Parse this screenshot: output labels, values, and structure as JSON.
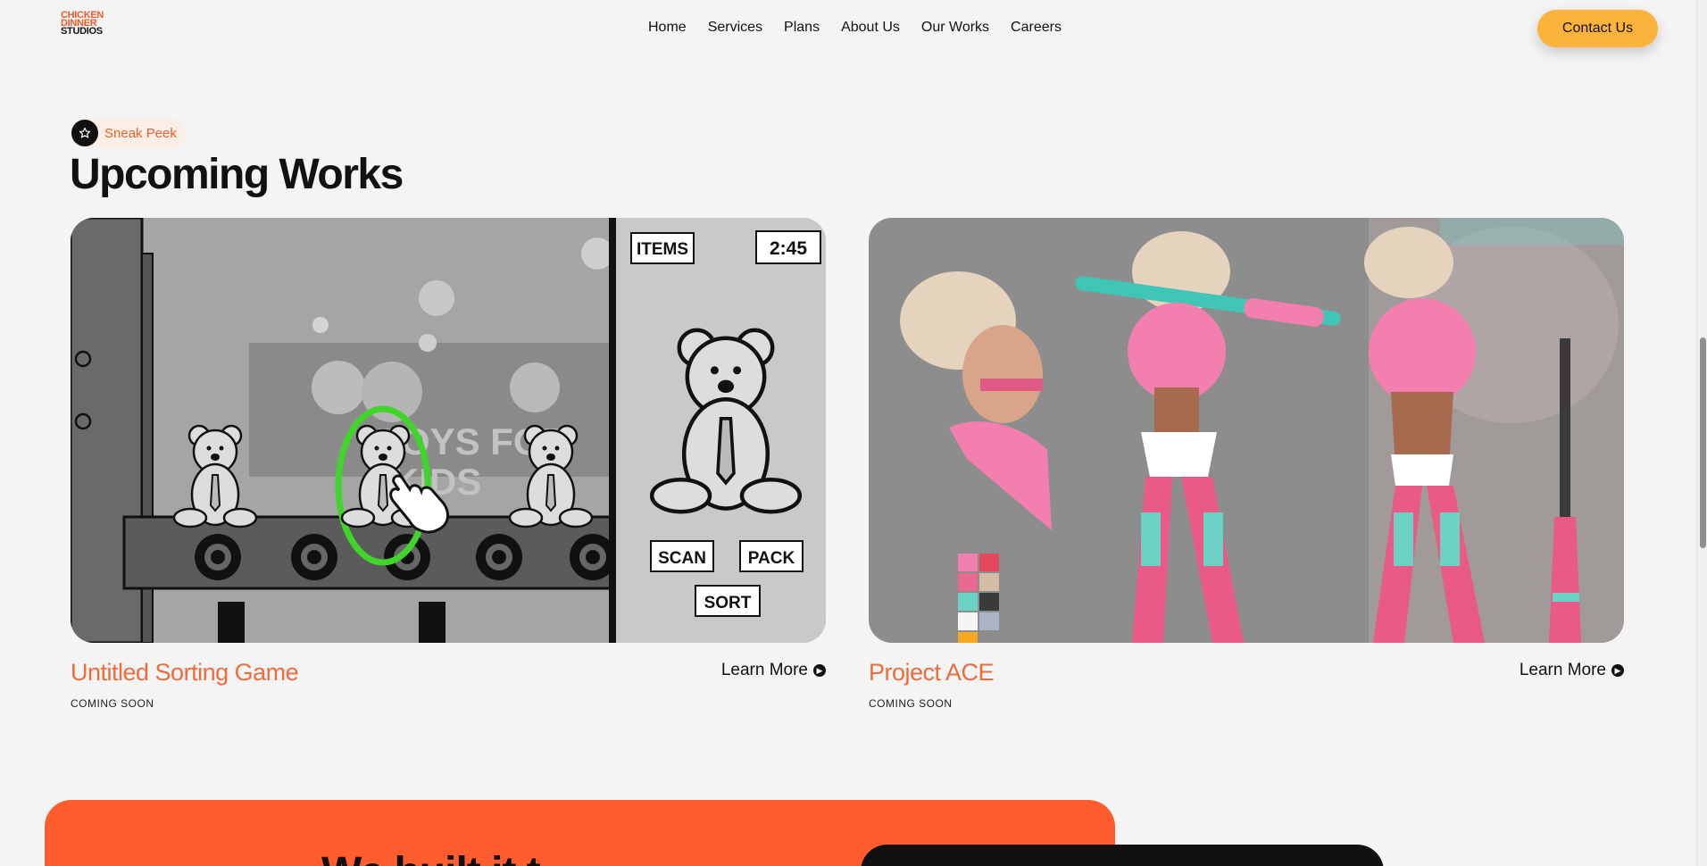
{
  "header": {
    "logo_lines": [
      "CHICKEN",
      "DINNER",
      "STUDIOS"
    ],
    "nav": [
      "Home",
      "Services",
      "Plans",
      "About Us",
      "Our Works",
      "Careers"
    ],
    "contact": "Contact Us"
  },
  "section": {
    "badge": "Sneak Peek",
    "badge_icon": "star-icon",
    "title": "Upcoming Works"
  },
  "cards": [
    {
      "name": "Untitled Sorting Game",
      "status": "COMING SOON",
      "learn_more": "Learn More",
      "hud": {
        "items": "ITEMS",
        "time": "2:45",
        "scan": "SCAN",
        "pack": "PACK",
        "sort": "SORT",
        "sign": "TOYS FOR KIDS"
      }
    },
    {
      "name": "Project ACE",
      "status": "COMING SOON",
      "learn_more": "Learn More"
    }
  ],
  "banner": {
    "heading": "We built it t"
  },
  "colors": {
    "accent": "#ff5d2d",
    "button": "#fbb33b",
    "card_title": "#ee6b3c"
  }
}
